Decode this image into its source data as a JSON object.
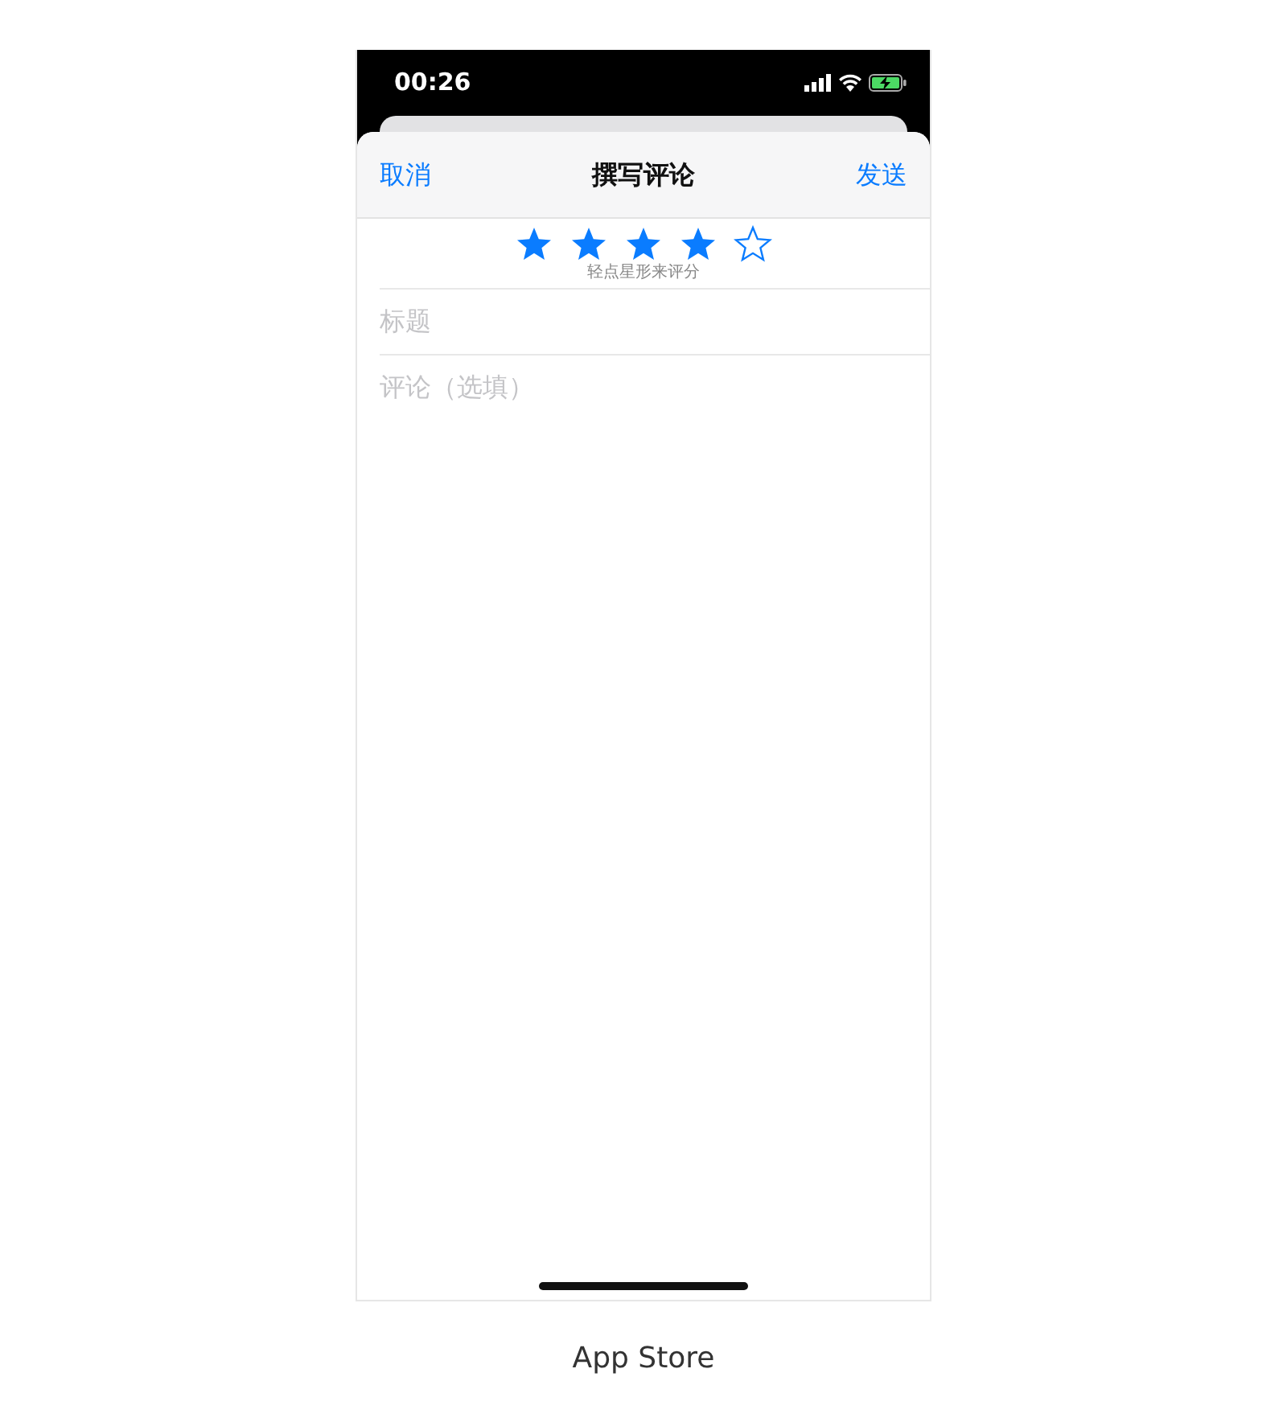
{
  "status_bar": {
    "time": "00:26"
  },
  "nav_bar": {
    "cancel": "取消",
    "title": "撰写评论",
    "send": "发送"
  },
  "rating": {
    "stars": 4,
    "hint": "轻点星形来评分"
  },
  "title_field": {
    "placeholder": "标题"
  },
  "review_field": {
    "placeholder": "评论（选填）"
  },
  "caption": "App Store"
}
